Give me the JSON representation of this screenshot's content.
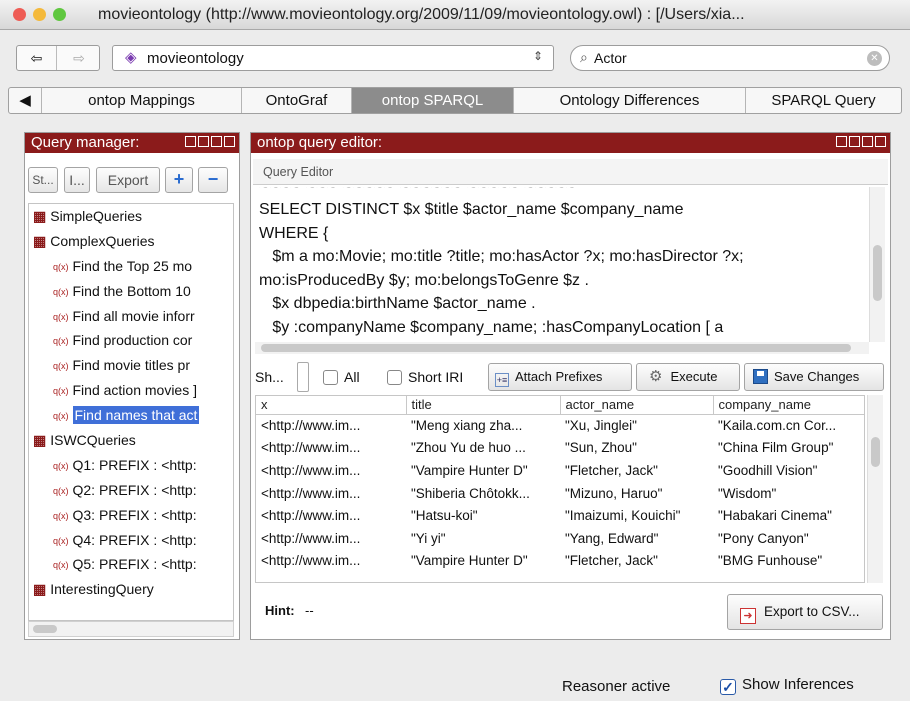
{
  "window": {
    "title": "movieontology (http://www.movieontology.org/2009/11/09/movieontology.owl) : [/Users/xia...",
    "light_colors": [
      "#ee5c55",
      "#f4b93b",
      "#5fc73f"
    ]
  },
  "toolbar": {
    "ontology_name": "movieontology",
    "search_value": "Actor"
  },
  "tabs": [
    "ontop Mappings",
    "OntoGraf",
    "ontop SPARQL",
    "Ontology Differences",
    "SPARQL Query"
  ],
  "query_manager": {
    "title": "Query manager:",
    "buttons": [
      "St...",
      "I...",
      "Export"
    ],
    "tree": [
      {
        "kind": "group",
        "label": "SimpleQueries"
      },
      {
        "kind": "group",
        "label": "ComplexQueries"
      },
      {
        "kind": "query",
        "label": "Find the Top 25 mo"
      },
      {
        "kind": "query",
        "label": "Find the Bottom 10"
      },
      {
        "kind": "query",
        "label": "Find all movie inforr"
      },
      {
        "kind": "query",
        "label": "Find production cor"
      },
      {
        "kind": "query",
        "label": "Find movie titles pr"
      },
      {
        "kind": "query",
        "label": "Find action movies ]"
      },
      {
        "kind": "query",
        "label": "Find names that act",
        "selected": true
      },
      {
        "kind": "group",
        "label": "ISWCQueries"
      },
      {
        "kind": "query",
        "label": "Q1: PREFIX : <http:"
      },
      {
        "kind": "query",
        "label": "Q2: PREFIX : <http:"
      },
      {
        "kind": "query",
        "label": "Q3: PREFIX : <http:"
      },
      {
        "kind": "query",
        "label": "Q4: PREFIX : <http:"
      },
      {
        "kind": "query",
        "label": "Q5: PREFIX : <http:"
      },
      {
        "kind": "group",
        "label": "InterestingQuery"
      }
    ]
  },
  "query_editor": {
    "title": "ontop query editor:",
    "section_label": "Query Editor",
    "lines": [
      "SELECT DISTINCT $x $title $actor_name $company_name",
      "WHERE {",
      "   $m a mo:Movie; mo:title ?title; mo:hasActor ?x; mo:hasDirector ?x;",
      "mo:isProducedBy $y; mo:belongsToGenre $z .",
      "   $x dbpedia:birthName $actor_name .",
      "   $y :companyName $company_name; :hasCompanyLocation [ a"
    ]
  },
  "results_toolbar": {
    "show_label": "Sh...",
    "all_label": "All",
    "short_iri_label": "Short IRI",
    "attach_prefixes": "Attach Prefixes",
    "execute": "Execute",
    "save_changes": "Save Changes"
  },
  "results": {
    "columns": [
      "x",
      "title",
      "actor_name",
      "company_name"
    ],
    "rows": [
      [
        "<http://www.im...",
        "\"Meng xiang zha...",
        "\"Xu, Jinglei\"",
        "\"Kaila.com.cn Cor..."
      ],
      [
        "<http://www.im...",
        "\"Zhou Yu de huo ...",
        "\"Sun, Zhou\"",
        "\"China Film Group\""
      ],
      [
        "<http://www.im...",
        "\"Vampire Hunter D\"",
        "\"Fletcher, Jack\"",
        "\"Goodhill Vision\""
      ],
      [
        "<http://www.im...",
        "\"Shiberia Chôtokk...",
        "\"Mizuno, Haruo\"",
        "\"Wisdom\""
      ],
      [
        "<http://www.im...",
        "\"Hatsu-koi\"",
        "\"Imaizumi, Kouichi\"",
        "\"Habakari Cinema\""
      ],
      [
        "<http://www.im...",
        "\"Yi yi\"",
        "\"Yang, Edward\"",
        "\"Pony Canyon\""
      ],
      [
        "<http://www.im...",
        "\"Vampire Hunter D\"",
        "\"Fletcher, Jack\"",
        "\"BMG Funhouse\""
      ]
    ]
  },
  "footer": {
    "hint_label": "Hint:",
    "hint_value": "--",
    "export_csv": "Export to CSV...",
    "reasoner_status": "Reasoner active",
    "show_inferences": "Show Inferences"
  },
  "colors": {
    "panel_header": "#8b1b1b",
    "selection": "#3f6fd8",
    "selected_tab": "#8c8c8c"
  }
}
